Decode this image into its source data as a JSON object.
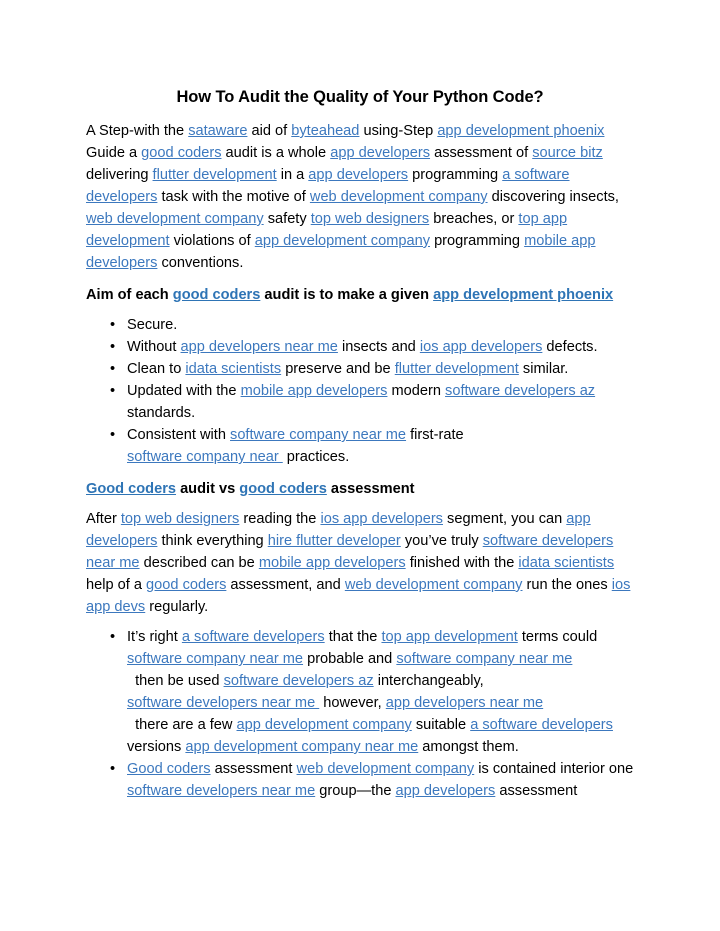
{
  "document": {
    "title": "How To Audit the Quality of Your Python Code?",
    "link_color": "#3C78BE",
    "heading_link_color": "#2E74B5",
    "text_color": "#000000",
    "background_color": "#ffffff",
    "bullet_glyph": "•"
  },
  "paragraph1": {
    "t0": "A Step-with the ",
    "l1": "sataware",
    "t1": " aid of ",
    "l2": "byteahead",
    "t2": " using-Step ",
    "l3": "app development phoenix",
    "t3": " Guide a ",
    "l4": "good coders",
    "t4": " audit is a whole ",
    "l5": "app developers",
    "t5": " assessment of ",
    "l6": "source bitz",
    "t6": " delivering ",
    "l7": "flutter development",
    "t7": " in a ",
    "l8": "app developers",
    "t8": " programming ",
    "l9": "a software developers",
    "t9": " task with the motive of ",
    "l10": "web development company",
    "t10": " discovering insects, ",
    "l11": "web development company",
    "t11": " safety ",
    "l12": "top web designers",
    "t12": " breaches, or ",
    "l13": "top app development",
    "t13": " violations of ",
    "l14": "app development company",
    "t14": " programming ",
    "l15": "mobile app developers",
    "t15": " conventions."
  },
  "heading1": {
    "t0": "Aim of each ",
    "l1": "good coders",
    "t1": " audit is to make a given ",
    "l2": "app development phoenix"
  },
  "list1": {
    "item1": {
      "t0": "Secure."
    },
    "item2": {
      "t0": "Without ",
      "l1": "app developers near me",
      "t1": " insects and ",
      "l2": "ios app developers",
      "t2": " defects."
    },
    "item3": {
      "t0": "Clean to ",
      "l1": "idata scientists",
      "t1": " preserve and be ",
      "l2": "flutter development",
      "t2": " similar."
    },
    "item4": {
      "t0": "Updated with the ",
      "l1": "mobile app developers",
      "t1": " modern ",
      "l2": "software developers az",
      "t2": " standards."
    },
    "item5": {
      "t0": "Consistent with ",
      "l1": "software company near me",
      "t1": " first-rate ",
      "l2": "software company near ",
      "t2": " practices."
    }
  },
  "heading2": {
    "l0": "Good coders",
    "t0": " audit vs ",
    "l1": "good coders",
    "t1": " assessment"
  },
  "paragraph2": {
    "t0": "After ",
    "l1": "top web designers",
    "t1": " reading the ",
    "l2": "ios app developers",
    "t2": " segment, you can ",
    "l3": "app developers",
    "t3": " think everything ",
    "l4": "hire flutter developer",
    "t4": " you’ve truly ",
    "l5": "software developers near me",
    "t5": " described can be ",
    "l6": "mobile app developers",
    "t6": " finished with the ",
    "l7": "idata scientists",
    "t7": " help of a ",
    "l8": "good coders",
    "t8": " assessment, and ",
    "l9": "web development company",
    "t9": " run the ones ",
    "l10": "ios app devs",
    "t10": " regularly."
  },
  "list2": {
    "item1": {
      "t0": "It’s right ",
      "l1": "a software developers",
      "t1": " that the ",
      "l2": "top app development",
      "t2": " terms could ",
      "l3": "software company near me",
      "t3": " probable and ",
      "l4": "software company near me",
      "t4": "  then be used ",
      "l5": "software developers az",
      "t5": " interchangeably, ",
      "l6": "software developers near me ",
      "t6": " however, ",
      "l7": "app developers near me",
      "t7": "  there are a few ",
      "l8": "app development company",
      "t8": " suitable ",
      "l9": "a software developers",
      "t9": " versions ",
      "l10": "app development company near me",
      "t10": " amongst them."
    },
    "item2": {
      "l0": "Good coders",
      "t0": " assessment ",
      "l1": "web development company",
      "t1": " is contained interior one ",
      "l2": "software developers near me",
      "t2": " group—the ",
      "l3": "app developers",
      "t3": " assessment"
    }
  }
}
